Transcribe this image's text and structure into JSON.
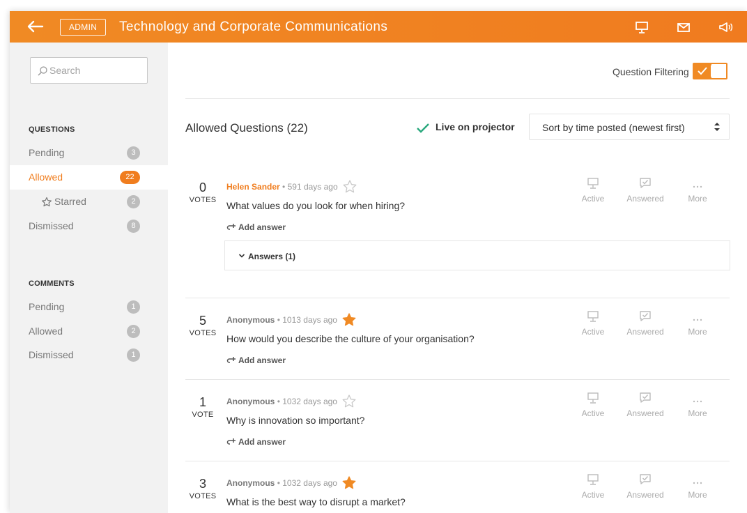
{
  "header": {
    "badge": "ADMIN",
    "title": "Technology and Corporate Communications",
    "icons": [
      "back-arrow-icon",
      "projector-icon",
      "mail-icon",
      "megaphone-icon"
    ],
    "accent": "#f08a24"
  },
  "search": {
    "placeholder": "Search"
  },
  "sidebar": {
    "questions_heading": "QUESTIONS",
    "questions": [
      {
        "label": "Pending",
        "count": "3"
      },
      {
        "label": "Allowed",
        "count": "22",
        "active": true
      },
      {
        "label": "Starred",
        "count": "2",
        "icon": "star-outline-icon"
      },
      {
        "label": "Dismissed",
        "count": "8"
      }
    ],
    "comments_heading": "COMMENTS",
    "comments": [
      {
        "label": "Pending",
        "count": "1"
      },
      {
        "label": "Allowed",
        "count": "2"
      },
      {
        "label": "Dismissed",
        "count": "1"
      }
    ]
  },
  "main": {
    "filter_label": "Question Filtering",
    "filter_on": true,
    "heading": "Allowed Questions (22)",
    "live_label": "Live on projector",
    "sort_value": "Sort by time posted (newest first)",
    "actions": {
      "active": "Active",
      "answered": "Answered",
      "more": "More"
    },
    "add_answer": "Add answer",
    "separator": "•",
    "questions": [
      {
        "votes": "0",
        "votes_label": "VOTES",
        "author": "Helen Sander",
        "age": "591 days ago",
        "starred": false,
        "text": "What values do you look for when hiring?",
        "answers_label": "Answers (1)"
      },
      {
        "votes": "5",
        "votes_label": "VOTES",
        "author": "Anonymous",
        "age": "1013 days ago",
        "starred": true,
        "text": "How would you describe the culture of your organisation?"
      },
      {
        "votes": "1",
        "votes_label": "VOTE",
        "author": "Anonymous",
        "age": "1032 days ago",
        "starred": false,
        "text": "Why is innovation so important?"
      },
      {
        "votes": "3",
        "votes_label": "VOTES",
        "author": "Anonymous",
        "age": "1032 days ago",
        "starred": true,
        "text": "What is the best way to disrupt a market?"
      }
    ]
  }
}
